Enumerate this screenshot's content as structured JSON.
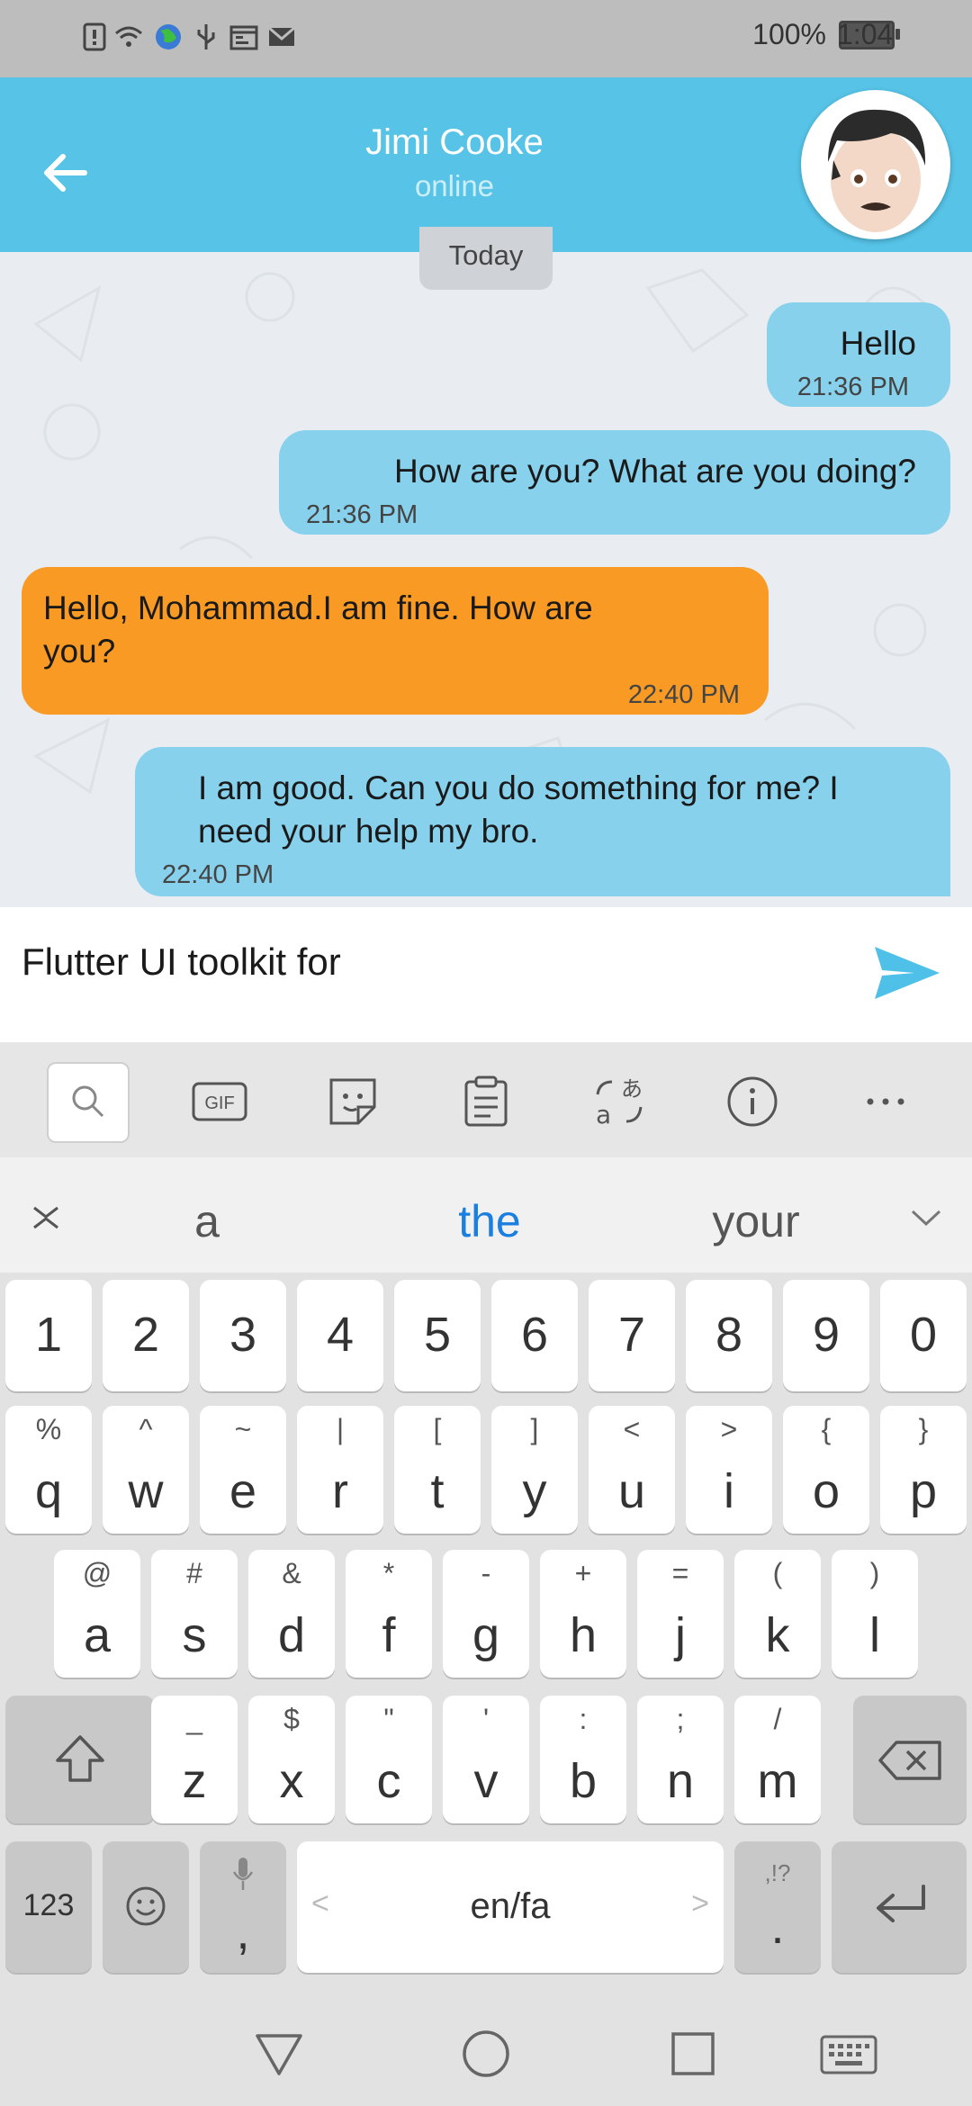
{
  "status_bar": {
    "battery_percent": "100%",
    "time": "1:04"
  },
  "header": {
    "contact_name": "Jimi Cooke",
    "contact_status": "online"
  },
  "chat": {
    "date_label": "Today",
    "messages": [
      {
        "direction": "outgoing",
        "text": "Hello",
        "time": "21:36 PM"
      },
      {
        "direction": "outgoing",
        "text": "How are you? What are you doing?",
        "time": "21:36 PM"
      },
      {
        "direction": "incoming",
        "text_lines": [
          "Hello, Mohammad.I am fine. How are",
          "you?"
        ],
        "time": "22:40 PM"
      },
      {
        "direction": "outgoing",
        "text_lines": [
          "I am good. Can you do something for me? I",
          "need your help my bro."
        ],
        "time": "22:40 PM"
      }
    ]
  },
  "composer": {
    "value": "Flutter UI toolkit for"
  },
  "keyboard": {
    "suggestions": [
      "a",
      "the",
      "your"
    ],
    "row_numbers": [
      "1",
      "2",
      "3",
      "4",
      "5",
      "6",
      "7",
      "8",
      "9",
      "0"
    ],
    "row_q": {
      "main": [
        "q",
        "w",
        "e",
        "r",
        "t",
        "y",
        "u",
        "i",
        "o",
        "p"
      ],
      "alt": [
        "%",
        "^",
        "~",
        "|",
        "[",
        "]",
        "<",
        ">",
        "{",
        "}"
      ]
    },
    "row_a": {
      "main": [
        "a",
        "s",
        "d",
        "f",
        "g",
        "h",
        "j",
        "k",
        "l"
      ],
      "alt": [
        "@",
        "#",
        "&",
        "*",
        "-",
        "+",
        "=",
        "(",
        ")"
      ]
    },
    "row_z": {
      "main": [
        "z",
        "x",
        "c",
        "v",
        "b",
        "n",
        "m"
      ],
      "alt": [
        "_",
        "$",
        "\"",
        "'",
        ":",
        ";",
        "/"
      ]
    },
    "bottom": {
      "numbers_label": "123",
      "comma": ",",
      "space_label": "en/fa",
      "period": ".",
      "period_alt": ",!?"
    }
  },
  "colors": {
    "header": "#56c3e7",
    "outgoing_bubble": "#87d1ec",
    "incoming_bubble": "#f89a24",
    "send_icon": "#4fc1e9",
    "suggestion_active": "#1a7fe0"
  },
  "icons": [
    "back-arrow-icon",
    "send-icon",
    "search-icon",
    "gif-icon",
    "sticker-icon",
    "clipboard-icon",
    "translate-icon",
    "info-icon",
    "more-icon",
    "collapse-icon",
    "expand-icon",
    "shift-icon",
    "backspace-icon",
    "emoji-icon",
    "mic-icon",
    "enter-icon"
  ]
}
